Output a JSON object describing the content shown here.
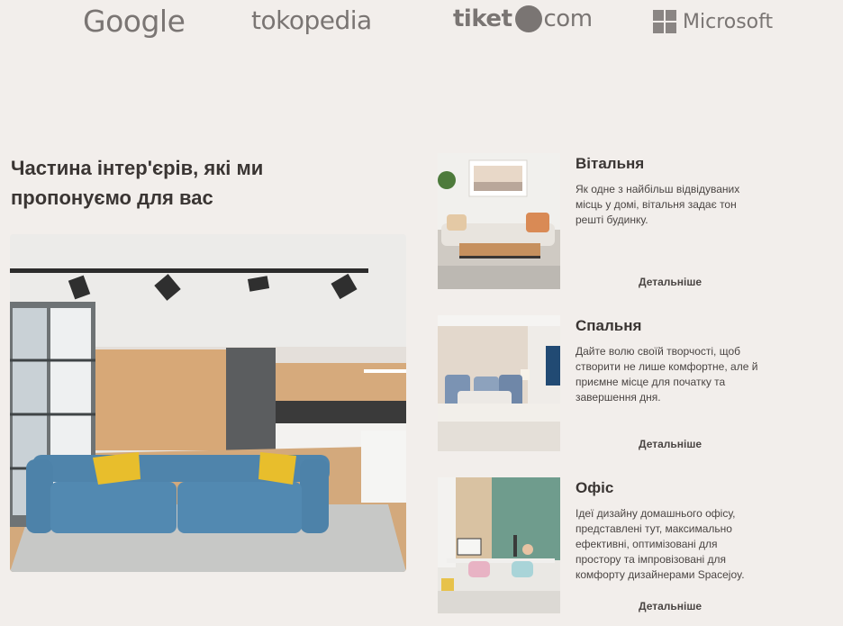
{
  "partners": {
    "google": "Google",
    "tokopedia": "tokopedia",
    "tiket_prefix": "tiket",
    "tiket_suffix": "com",
    "microsoft": "Microsoft"
  },
  "section": {
    "title": "Частина інтер'єрів, які ми пропонуємо для вас"
  },
  "rooms": [
    {
      "title": "Вітальня",
      "description": "Як одне з найбільш відвідуваних місць у домі, вітальня задає тон решті будинку.",
      "link": "Детальніше"
    },
    {
      "title": "Спальня",
      "description": "Дайте волю своїй творчості, щоб створити не лише комфортне, але й приємне місце для початку та завершення дня.",
      "link": "Детальніше"
    },
    {
      "title": "Офіс",
      "description": "Ідеї дизайну домашнього офісу, представлені тут, максимально ефективні, оптимізовані для простору та імпровізовані для комфорту дизайнерами Spacejoy.",
      "link": "Детальніше"
    }
  ]
}
